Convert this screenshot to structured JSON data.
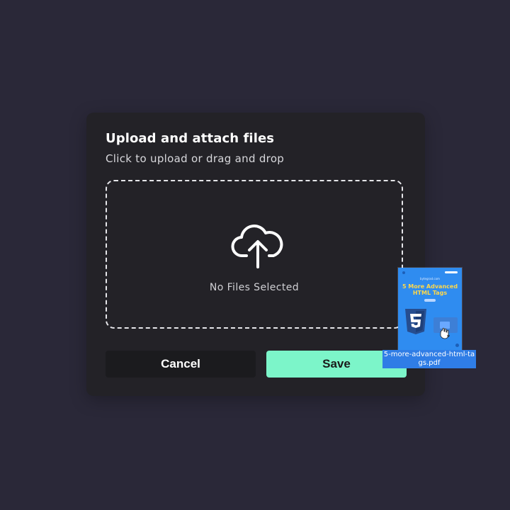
{
  "dialog": {
    "title": "Upload and attach files",
    "subtitle": "Click to upload or drag and drop",
    "dropzone": {
      "icon": "cloud-upload-icon",
      "empty_text": "No Files Selected"
    },
    "buttons": {
      "cancel_label": "Cancel",
      "save_label": "Save"
    }
  },
  "drag_item": {
    "file_name": "5-more-advanced-html-tags.pdf",
    "thumbnail": {
      "small_text": "bytegrad.com",
      "title": "5 More Advanced HTML Tags",
      "logo": "html5-icon"
    }
  },
  "colors": {
    "background": "#2a2838",
    "panel": "#232227",
    "accent": "#7cf5c9",
    "drag_highlight": "#2f8cf0"
  }
}
